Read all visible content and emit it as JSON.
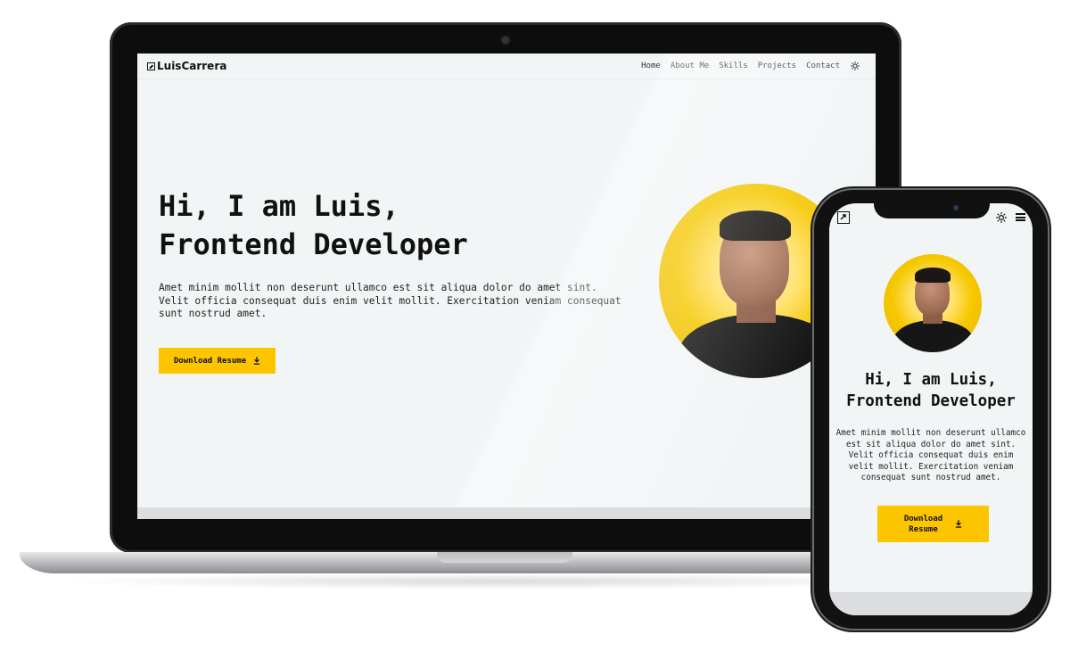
{
  "desktop": {
    "logo_text": "LuisCarrera",
    "nav": [
      "Home",
      "About Me",
      "Skills",
      "Projects",
      "Contact"
    ],
    "hero_title_line1": "Hi, I am Luis,",
    "hero_title_line2": "Frontend Developer",
    "hero_text": "Amet minim mollit non deserunt ullamco est sit aliqua dolor do amet sint. Velit officia consequat duis enim velit mollit. Exercitation veniam consequat sunt nostrud amet.",
    "button_label": "Download Resume",
    "accent": "#fdc500",
    "theme_icon": "sun-icon",
    "download_icon": "download-icon"
  },
  "mobile": {
    "hero_title_line1": "Hi, I am Luis,",
    "hero_title_line2": "Frontend Developer",
    "hero_text": "Amet minim mollit non deserunt ullamco est sit aliqua dolor do amet sint. Velit officia consequat duis enim velit mollit. Exercitation veniam consequat sunt nostrud amet.",
    "button_line1": "Download",
    "button_line2": "Resume",
    "menu_icon": "hamburger-menu-icon",
    "theme_icon": "sun-icon",
    "logo_icon": "logo-icon"
  }
}
